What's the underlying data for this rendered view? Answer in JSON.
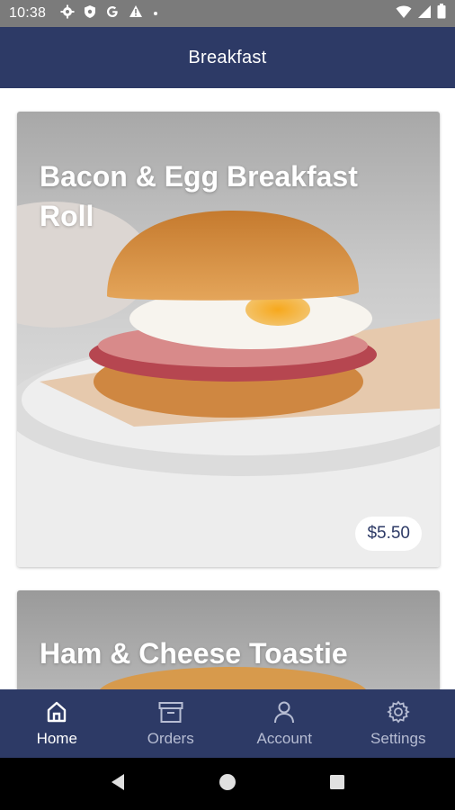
{
  "status_bar": {
    "time": "10:38",
    "icons": [
      "gear-icon",
      "shield-icon",
      "google-icon",
      "warning-icon",
      "dot-icon"
    ],
    "right_icons": [
      "wifi-icon",
      "signal-icon",
      "battery-icon"
    ]
  },
  "app_bar": {
    "title": "Breakfast"
  },
  "products": [
    {
      "name": "Bacon & Egg Breakfast Roll",
      "price": "$5.50"
    },
    {
      "name": "Ham & Cheese Toastie"
    }
  ],
  "bottom_nav": {
    "items": [
      {
        "label": "Home",
        "icon": "home-icon",
        "active": true
      },
      {
        "label": "Orders",
        "icon": "archive-box-icon",
        "active": false
      },
      {
        "label": "Account",
        "icon": "person-icon",
        "active": false
      },
      {
        "label": "Settings",
        "icon": "gear-icon",
        "active": false
      }
    ]
  },
  "system_nav": {
    "icons": [
      "back-icon",
      "home-circle-icon",
      "recents-icon"
    ]
  },
  "colors": {
    "primary": "#2d3a66",
    "status_bar": "#7b7b7b",
    "price_text": "#2d3a66"
  }
}
